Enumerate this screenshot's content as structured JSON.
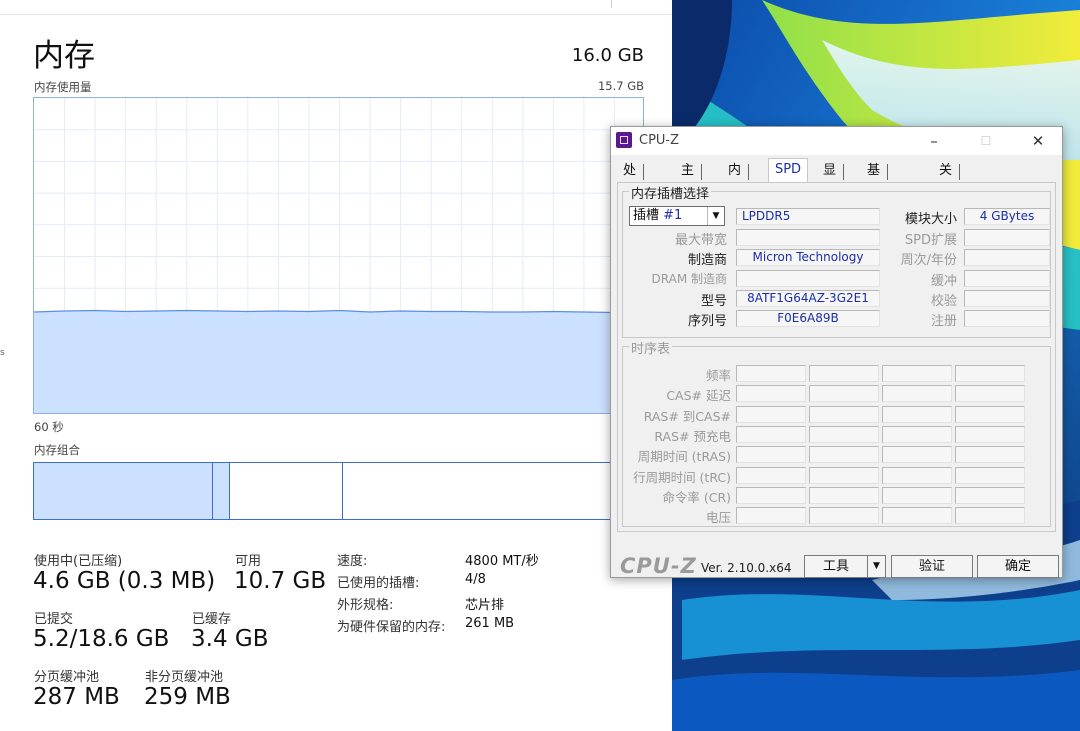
{
  "taskmanager": {
    "title": "内存",
    "total": "16.0 GB",
    "usage_label": "内存使用量",
    "usage_max": "15.7 GB",
    "time_label": "60 秒",
    "composition_label": "内存组合",
    "edge_mark": "s",
    "graph": {
      "fill_color": "#cce0ff",
      "line_color": "#5b8fe0",
      "grid_color": "#e4ecf8",
      "usage_level": 0.325
    },
    "composition": {
      "in_use": 0.295,
      "modified": 0.027,
      "standby": 0.187,
      "free": 0.491,
      "fill_color": "#cce0ff",
      "border_color": "#3a6fd0"
    },
    "stats": {
      "in_use_label": "使用中(已压缩)",
      "in_use_value": "4.6 GB (0.3 MB)",
      "available_label": "可用",
      "available_value": "10.7 GB",
      "committed_label": "已提交",
      "committed_value": "5.2/18.6 GB",
      "cached_label": "已缓存",
      "cached_value": "3.4 GB",
      "paged_label": "分页缓冲池",
      "paged_value": "287 MB",
      "nonpaged_label": "非分页缓冲池",
      "nonpaged_value": "259 MB"
    },
    "details": [
      {
        "key": "速度:",
        "value": "4800 MT/秒"
      },
      {
        "key": "已使用的插槽:",
        "value": "4/8"
      },
      {
        "key": "外形规格:",
        "value": "芯片排"
      },
      {
        "key": "为硬件保留的内存:",
        "value": "261 MB"
      }
    ]
  },
  "cpuz": {
    "window_title": "CPU-Z",
    "minimize": "–",
    "maximize": "☐",
    "close": "✕",
    "tabs": [
      {
        "label": "处理器",
        "active": false
      },
      {
        "label": "主板",
        "active": false
      },
      {
        "label": "内存",
        "active": false
      },
      {
        "label": "SPD",
        "active": true
      },
      {
        "label": "显卡",
        "active": false
      },
      {
        "label": "基准跑分",
        "active": false
      },
      {
        "label": "关于",
        "active": false
      }
    ],
    "slot_group_title": "内存插槽选择",
    "slot_select_prefix": "插槽",
    "slot_select_value": "#1",
    "memory_type": "LPDDR5",
    "module_size_label": "模块大小",
    "module_size_value": "4 GBytes",
    "max_bandwidth_label": "最大带宽",
    "spd_ext_label": "SPD扩展",
    "manufacturer_label": "制造商",
    "manufacturer_value": "Micron Technology",
    "week_year_label": "周次/年份",
    "dram_manufacturer_label": "DRAM 制造商",
    "buffered_label": "缓冲",
    "part_number_label": "型号",
    "part_number_value": "8ATF1G64AZ-3G2E1",
    "correction_label": "校验",
    "serial_label": "序列号",
    "serial_value": "F0E6A89B",
    "registered_label": "注册",
    "timings_group_title": "时序表",
    "timing_rows": [
      "频率",
      "CAS# 延迟",
      "RAS# 到CAS#",
      "RAS# 预充电",
      "周期时间 (tRAS)",
      "行周期时间 (tRC)",
      "命令率 (CR)",
      "电压"
    ],
    "brand": "CPU-Z",
    "version": "Ver. 2.10.0.x64",
    "tools_button": "工具",
    "validate_button": "验证",
    "ok_button": "确定"
  }
}
